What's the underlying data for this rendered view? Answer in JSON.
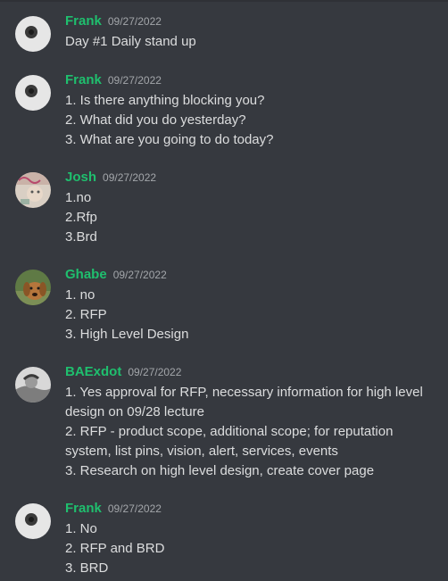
{
  "messages": [
    {
      "author": "Frank",
      "avatar_icon": "frank-avatar",
      "timestamp": "09/27/2022",
      "lines": [
        "Day #1 Daily stand up"
      ]
    },
    {
      "author": "Frank",
      "avatar_icon": "frank-avatar",
      "timestamp": "09/27/2022",
      "lines": [
        "1. Is there anything blocking you?",
        "2. What did you do yesterday?",
        "3. What are you going to do today?"
      ]
    },
    {
      "author": "Josh",
      "avatar_icon": "josh-avatar",
      "timestamp": "09/27/2022",
      "lines": [
        "1.no",
        "2.Rfp",
        "3.Brd"
      ]
    },
    {
      "author": "Ghabe",
      "avatar_icon": "dog-avatar",
      "timestamp": "09/27/2022",
      "lines": [
        "1. no",
        "2. RFP",
        "3. High Level Design"
      ]
    },
    {
      "author": "BAExdot",
      "avatar_icon": "baexdot-avatar",
      "timestamp": "09/27/2022",
      "lines": [
        "1. Yes approval for RFP, necessary information for high level design on 09/28 lecture",
        "2. RFP - product scope, additional scope; for reputation system, list pins, vision, alert, services, events",
        "3. Research on high level design, create cover page"
      ]
    },
    {
      "author": "Frank",
      "avatar_icon": "frank-avatar",
      "timestamp": "09/27/2022",
      "lines": [
        "1. No",
        "2. RFP and BRD",
        "3. BRD"
      ]
    }
  ],
  "colors": {
    "background": "#36393f",
    "author": "#1fbf6e",
    "text": "#dcddde",
    "timestamp": "#a3a6aa"
  }
}
